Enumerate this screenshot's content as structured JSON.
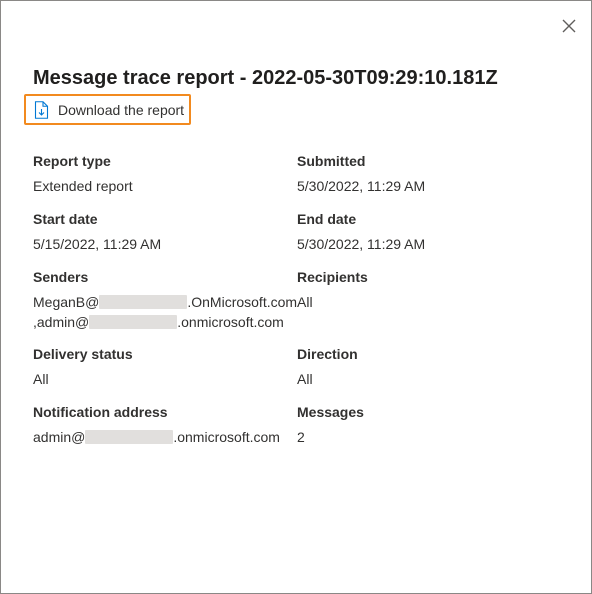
{
  "panel": {
    "title": "Message trace report - 2022-05-30T09:29:10.181Z",
    "close_icon": "close-icon",
    "download": {
      "label": "Download the report",
      "icon": "document-download-icon"
    }
  },
  "details": {
    "report_type": {
      "label": "Report type",
      "value": "Extended report"
    },
    "submitted": {
      "label": "Submitted",
      "value": "5/30/2022, 11:29 AM"
    },
    "start_date": {
      "label": "Start date",
      "value": "5/15/2022, 11:29 AM"
    },
    "end_date": {
      "label": "End date",
      "value": "5/30/2022, 11:29 AM"
    },
    "senders": {
      "label": "Senders",
      "line1_prefix": "MeganB@",
      "line1_suffix": ".OnMicrosoft.com",
      "line2_prefix": ",admin@",
      "line2_suffix": ".onmicrosoft.com"
    },
    "recipients": {
      "label": "Recipients",
      "value": "All"
    },
    "delivery_status": {
      "label": "Delivery status",
      "value": "All"
    },
    "direction": {
      "label": "Direction",
      "value": "All"
    },
    "notification_address": {
      "label": "Notification address",
      "prefix": "admin@",
      "suffix": ".onmicrosoft.com"
    },
    "messages": {
      "label": "Messages",
      "value": "2"
    }
  },
  "colors": {
    "highlight_border": "#f28a1f",
    "text": "#323130",
    "redaction": "#e1dfdd"
  }
}
